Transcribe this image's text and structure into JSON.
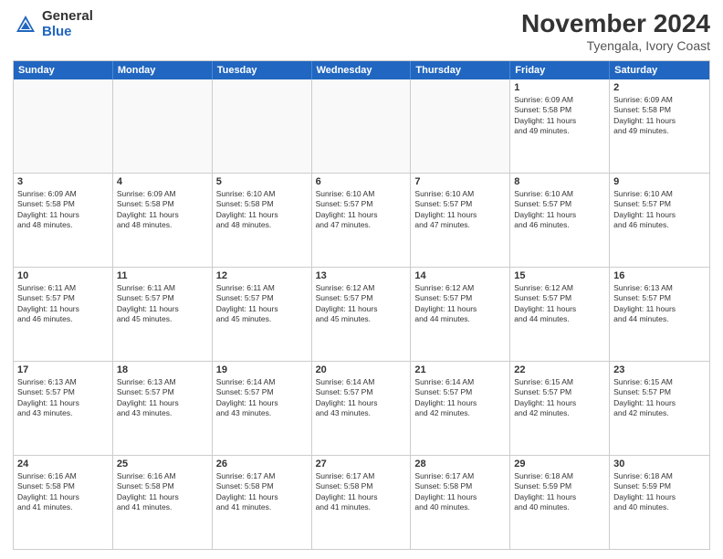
{
  "logo": {
    "general": "General",
    "blue": "Blue"
  },
  "header": {
    "month_year": "November 2024",
    "location": "Tyengala, Ivory Coast"
  },
  "weekdays": [
    "Sunday",
    "Monday",
    "Tuesday",
    "Wednesday",
    "Thursday",
    "Friday",
    "Saturday"
  ],
  "weeks": [
    [
      {
        "day": "",
        "info": "",
        "empty": true
      },
      {
        "day": "",
        "info": "",
        "empty": true
      },
      {
        "day": "",
        "info": "",
        "empty": true
      },
      {
        "day": "",
        "info": "",
        "empty": true
      },
      {
        "day": "",
        "info": "",
        "empty": true
      },
      {
        "day": "1",
        "info": "Sunrise: 6:09 AM\nSunset: 5:58 PM\nDaylight: 11 hours\nand 49 minutes.",
        "empty": false
      },
      {
        "day": "2",
        "info": "Sunrise: 6:09 AM\nSunset: 5:58 PM\nDaylight: 11 hours\nand 49 minutes.",
        "empty": false
      }
    ],
    [
      {
        "day": "3",
        "info": "Sunrise: 6:09 AM\nSunset: 5:58 PM\nDaylight: 11 hours\nand 48 minutes.",
        "empty": false
      },
      {
        "day": "4",
        "info": "Sunrise: 6:09 AM\nSunset: 5:58 PM\nDaylight: 11 hours\nand 48 minutes.",
        "empty": false
      },
      {
        "day": "5",
        "info": "Sunrise: 6:10 AM\nSunset: 5:58 PM\nDaylight: 11 hours\nand 48 minutes.",
        "empty": false
      },
      {
        "day": "6",
        "info": "Sunrise: 6:10 AM\nSunset: 5:57 PM\nDaylight: 11 hours\nand 47 minutes.",
        "empty": false
      },
      {
        "day": "7",
        "info": "Sunrise: 6:10 AM\nSunset: 5:57 PM\nDaylight: 11 hours\nand 47 minutes.",
        "empty": false
      },
      {
        "day": "8",
        "info": "Sunrise: 6:10 AM\nSunset: 5:57 PM\nDaylight: 11 hours\nand 46 minutes.",
        "empty": false
      },
      {
        "day": "9",
        "info": "Sunrise: 6:10 AM\nSunset: 5:57 PM\nDaylight: 11 hours\nand 46 minutes.",
        "empty": false
      }
    ],
    [
      {
        "day": "10",
        "info": "Sunrise: 6:11 AM\nSunset: 5:57 PM\nDaylight: 11 hours\nand 46 minutes.",
        "empty": false
      },
      {
        "day": "11",
        "info": "Sunrise: 6:11 AM\nSunset: 5:57 PM\nDaylight: 11 hours\nand 45 minutes.",
        "empty": false
      },
      {
        "day": "12",
        "info": "Sunrise: 6:11 AM\nSunset: 5:57 PM\nDaylight: 11 hours\nand 45 minutes.",
        "empty": false
      },
      {
        "day": "13",
        "info": "Sunrise: 6:12 AM\nSunset: 5:57 PM\nDaylight: 11 hours\nand 45 minutes.",
        "empty": false
      },
      {
        "day": "14",
        "info": "Sunrise: 6:12 AM\nSunset: 5:57 PM\nDaylight: 11 hours\nand 44 minutes.",
        "empty": false
      },
      {
        "day": "15",
        "info": "Sunrise: 6:12 AM\nSunset: 5:57 PM\nDaylight: 11 hours\nand 44 minutes.",
        "empty": false
      },
      {
        "day": "16",
        "info": "Sunrise: 6:13 AM\nSunset: 5:57 PM\nDaylight: 11 hours\nand 44 minutes.",
        "empty": false
      }
    ],
    [
      {
        "day": "17",
        "info": "Sunrise: 6:13 AM\nSunset: 5:57 PM\nDaylight: 11 hours\nand 43 minutes.",
        "empty": false
      },
      {
        "day": "18",
        "info": "Sunrise: 6:13 AM\nSunset: 5:57 PM\nDaylight: 11 hours\nand 43 minutes.",
        "empty": false
      },
      {
        "day": "19",
        "info": "Sunrise: 6:14 AM\nSunset: 5:57 PM\nDaylight: 11 hours\nand 43 minutes.",
        "empty": false
      },
      {
        "day": "20",
        "info": "Sunrise: 6:14 AM\nSunset: 5:57 PM\nDaylight: 11 hours\nand 43 minutes.",
        "empty": false
      },
      {
        "day": "21",
        "info": "Sunrise: 6:14 AM\nSunset: 5:57 PM\nDaylight: 11 hours\nand 42 minutes.",
        "empty": false
      },
      {
        "day": "22",
        "info": "Sunrise: 6:15 AM\nSunset: 5:57 PM\nDaylight: 11 hours\nand 42 minutes.",
        "empty": false
      },
      {
        "day": "23",
        "info": "Sunrise: 6:15 AM\nSunset: 5:57 PM\nDaylight: 11 hours\nand 42 minutes.",
        "empty": false
      }
    ],
    [
      {
        "day": "24",
        "info": "Sunrise: 6:16 AM\nSunset: 5:58 PM\nDaylight: 11 hours\nand 41 minutes.",
        "empty": false
      },
      {
        "day": "25",
        "info": "Sunrise: 6:16 AM\nSunset: 5:58 PM\nDaylight: 11 hours\nand 41 minutes.",
        "empty": false
      },
      {
        "day": "26",
        "info": "Sunrise: 6:17 AM\nSunset: 5:58 PM\nDaylight: 11 hours\nand 41 minutes.",
        "empty": false
      },
      {
        "day": "27",
        "info": "Sunrise: 6:17 AM\nSunset: 5:58 PM\nDaylight: 11 hours\nand 41 minutes.",
        "empty": false
      },
      {
        "day": "28",
        "info": "Sunrise: 6:17 AM\nSunset: 5:58 PM\nDaylight: 11 hours\nand 40 minutes.",
        "empty": false
      },
      {
        "day": "29",
        "info": "Sunrise: 6:18 AM\nSunset: 5:59 PM\nDaylight: 11 hours\nand 40 minutes.",
        "empty": false
      },
      {
        "day": "30",
        "info": "Sunrise: 6:18 AM\nSunset: 5:59 PM\nDaylight: 11 hours\nand 40 minutes.",
        "empty": false
      }
    ]
  ]
}
